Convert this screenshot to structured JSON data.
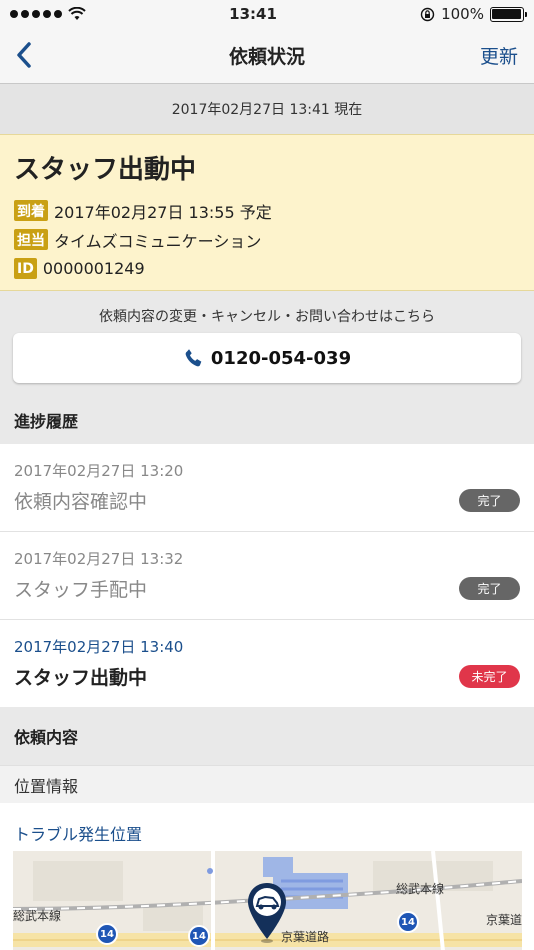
{
  "statusbar": {
    "time": "13:41",
    "battery": "100%"
  },
  "nav": {
    "title": "依頼状況",
    "refresh_label": "更新"
  },
  "timestamp": "2017年02月27日 13:41 現在",
  "status_card": {
    "title": "スタッフ出動中",
    "rows": [
      {
        "tag": "到着",
        "value": "2017年02月27日 13:55 予定"
      },
      {
        "tag": "担当",
        "value": "タイムズコミュニケーション"
      },
      {
        "tag": "ID",
        "value": "0000001249"
      }
    ]
  },
  "contact": {
    "note": "依頼内容の変更・キャンセル・お問い合わせはこちら",
    "phone": "0120-054-039"
  },
  "progress": {
    "header": "進捗履歴",
    "items": [
      {
        "time": "2017年02月27日 13:20",
        "label": "依頼内容確認中",
        "badge": "完了"
      },
      {
        "time": "2017年02月27日 13:32",
        "label": "スタッフ手配中",
        "badge": "完了"
      },
      {
        "time": "2017年02月27日 13:40",
        "label": "スタッフ出動中",
        "badge": "未完了"
      }
    ]
  },
  "request": {
    "header": "依頼内容",
    "subheader": "位置情報",
    "location_link": "トラブル発生位置"
  },
  "map": {
    "labels": {
      "line_left": "総武本線",
      "line_right": "総武本線",
      "road": "京葉道路",
      "road_right": "京葉道",
      "route": "14"
    }
  },
  "colors": {
    "accent": "#1b4f8c",
    "highlight_bg": "#fdf3cc",
    "tag": "#c9a014",
    "badge_done": "#666666",
    "badge_pending": "#e0364a"
  }
}
